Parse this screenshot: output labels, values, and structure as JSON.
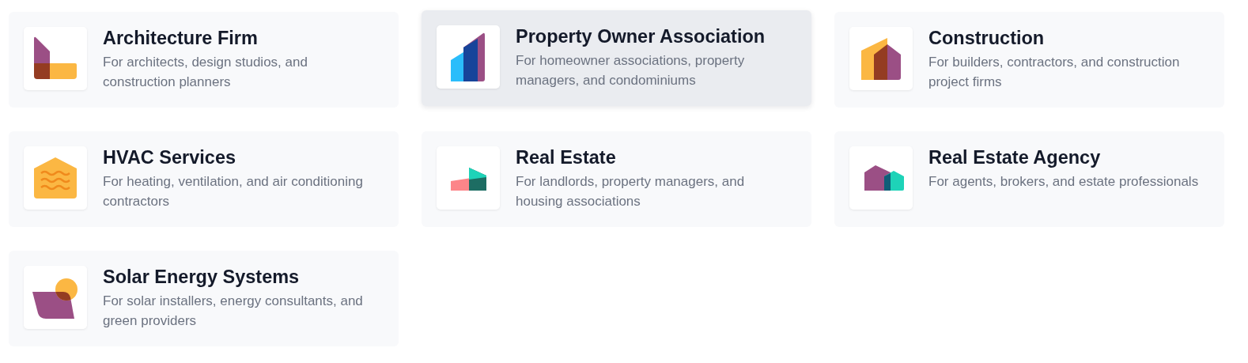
{
  "cards": [
    {
      "title": "Architecture Firm",
      "description": "For architects, design studios, and construction planners",
      "kind": "architecture",
      "selected": false
    },
    {
      "title": "Property Owner Association",
      "description": "For homeowner associations, property managers, and condominiums",
      "kind": "towers",
      "selected": true
    },
    {
      "title": "Construction",
      "description": "For builders, contractors, and construction project firms",
      "kind": "construction",
      "selected": false
    },
    {
      "title": "HVAC Services",
      "description": "For heating, ventilation, and air conditioning contractors",
      "kind": "hvac",
      "selected": false
    },
    {
      "title": "Real Estate",
      "description": "For landlords, property managers, and housing associations",
      "kind": "realestate",
      "selected": false
    },
    {
      "title": "Real Estate Agency",
      "description": "For agents, brokers, and estate professionals",
      "kind": "agency",
      "selected": false
    },
    {
      "title": "Solar Energy Systems",
      "description": "For solar installers, energy consultants, and green providers",
      "kind": "solar",
      "selected": false
    }
  ]
}
